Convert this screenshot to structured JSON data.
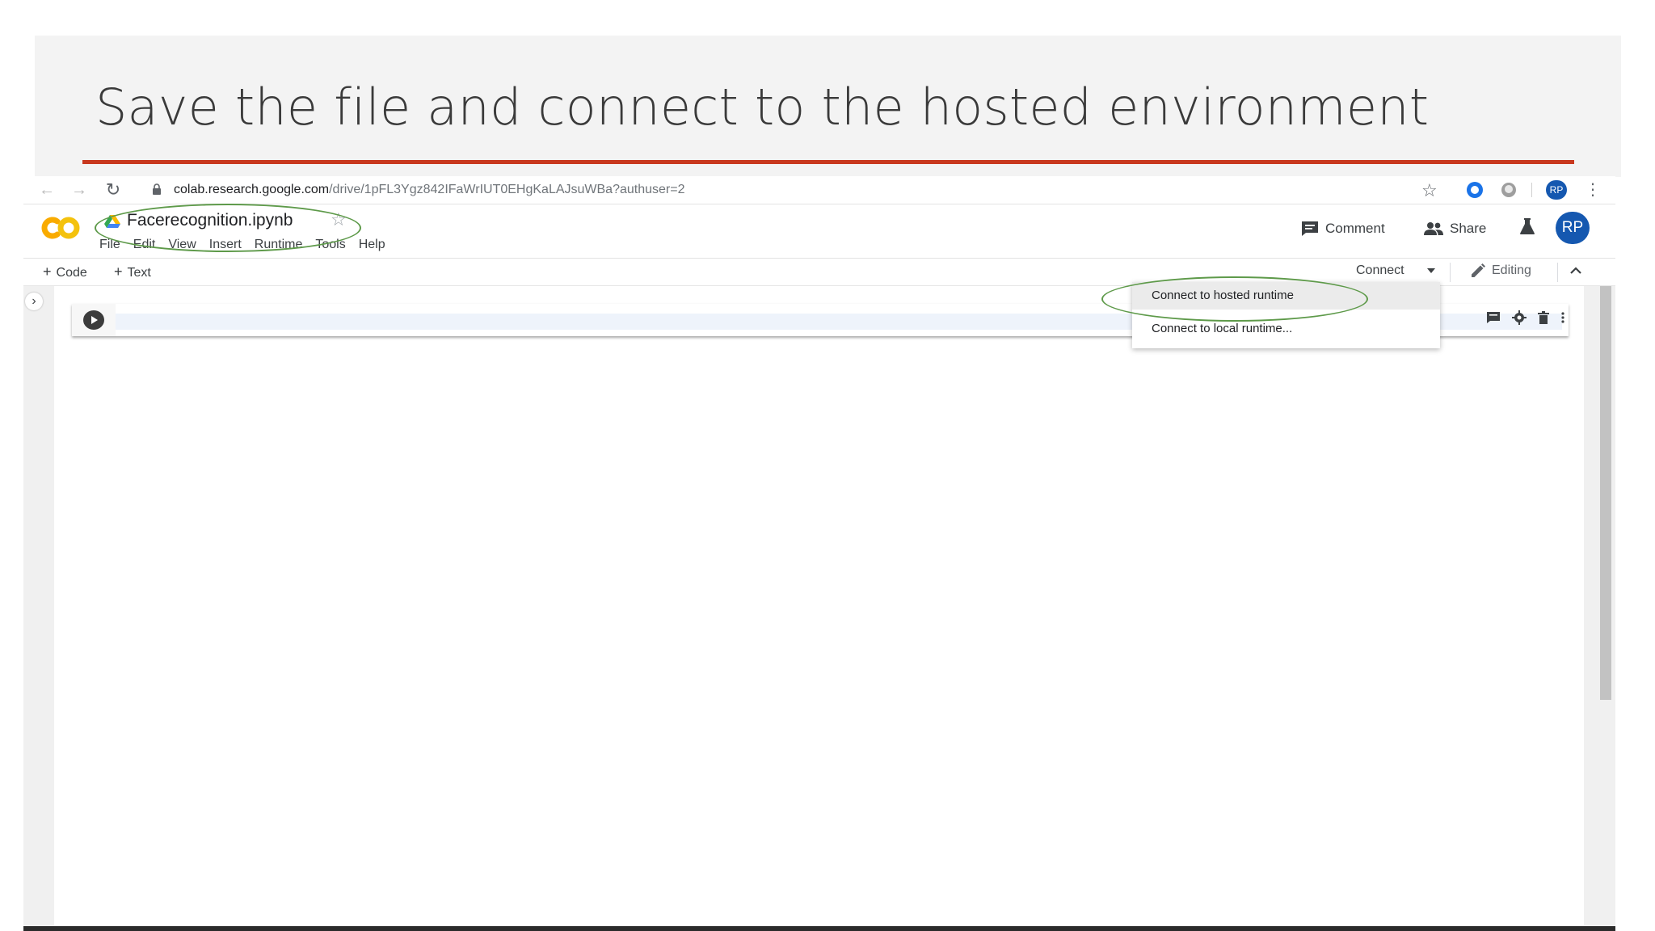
{
  "slide": {
    "title": "Save the file and connect to the hosted environment"
  },
  "browser": {
    "url_host": "colab.research.google.com",
    "url_path": "/drive/1pFL3Ygz842IFaWrIUT0EHgKaLAJsuWBa?authuser=2",
    "avatar_initials": "RP"
  },
  "colab": {
    "file_name": "Facerecognition.ipynb",
    "menu": [
      "File",
      "Edit",
      "View",
      "Insert",
      "Runtime",
      "Tools",
      "Help"
    ],
    "comment_label": "Comment",
    "share_label": "Share",
    "avatar_initials": "RP"
  },
  "toolbar": {
    "add_code_label": "Code",
    "add_text_label": "Text",
    "connect_label": "Connect",
    "editing_label": "Editing"
  },
  "connect_menu": {
    "items": [
      "Connect to hosted runtime",
      "Connect to local runtime..."
    ]
  },
  "colors": {
    "title_rule": "#c8381e",
    "annotation": "#5e9a4a",
    "colab_orange": "#f9ab00",
    "colab_yellow": "#f4c20d",
    "avatar_blue": "#1558b0"
  }
}
